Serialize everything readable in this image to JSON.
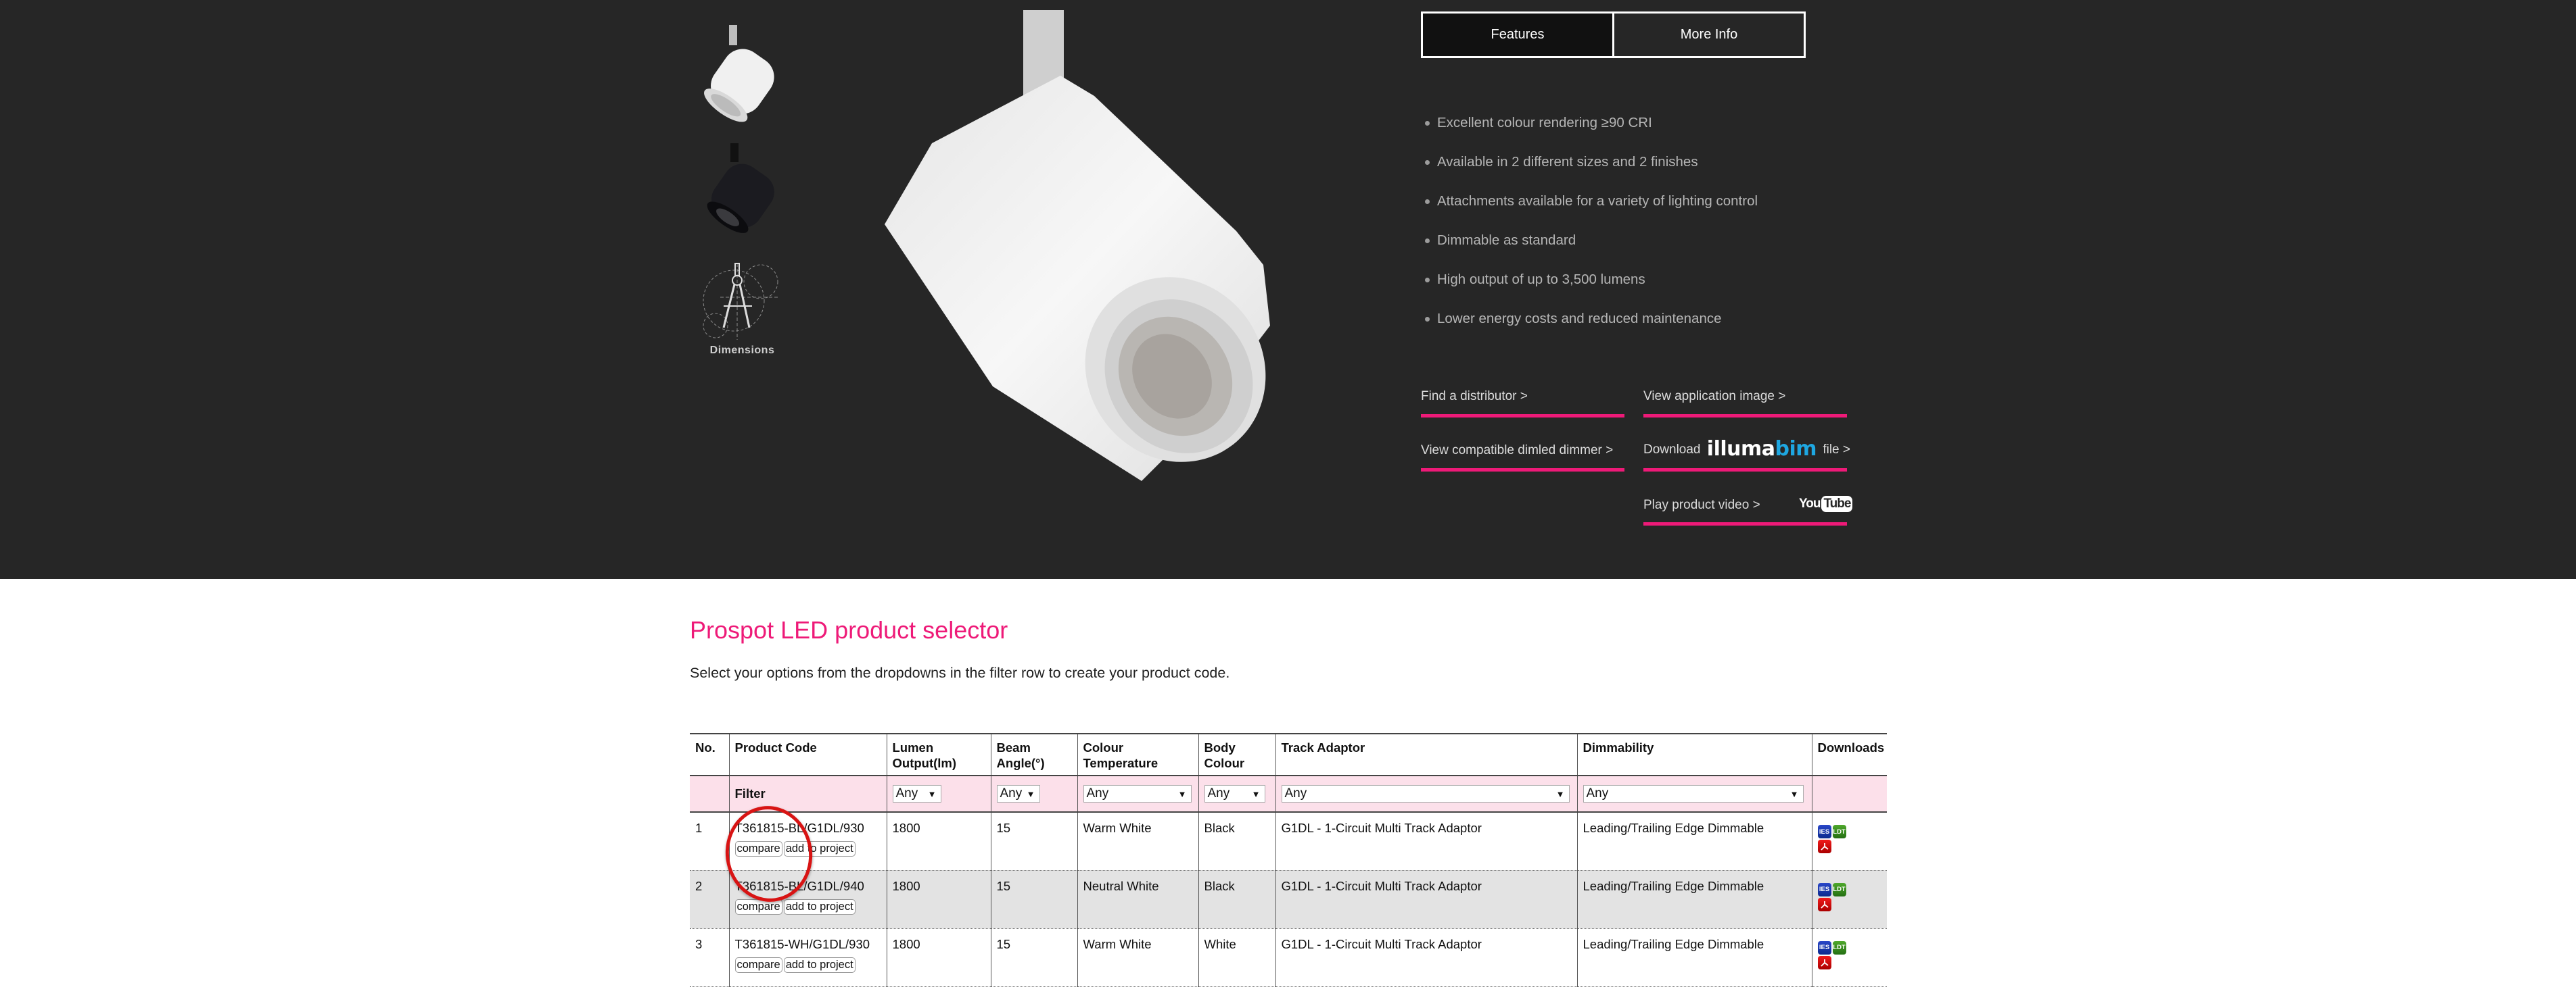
{
  "gallery": {
    "thumbnails": [
      {
        "name": "white-finish",
        "label": ""
      },
      {
        "name": "black-finish",
        "label": ""
      },
      {
        "name": "dimensions",
        "label": "Dimensions"
      }
    ]
  },
  "tabs": [
    {
      "label": "Features",
      "active": true
    },
    {
      "label": "More Info",
      "active": false
    }
  ],
  "features": [
    "Excellent colour rendering ≥90 CRI",
    "Available in 2 different sizes and 2 finishes",
    "Attachments available for a variety of lighting control",
    "Dimmable as standard",
    "High output of up to 3,500 lumens",
    "Lower energy costs and reduced maintenance"
  ],
  "links": {
    "find_distributor": "Find a distributor >",
    "view_application_image": "View application image >",
    "view_dimmer": "View compatible dimled dimmer >",
    "download_prefix": "Download",
    "illumabim_logo_part1": "illuma",
    "illumabim_logo_part2": "bim",
    "download_suffix": "file >",
    "play_video": "Play product video >",
    "youtube_you": "You",
    "youtube_tube": "Tube"
  },
  "colors": {
    "accent_pink": "#ee1a78",
    "dark_bg": "#262626",
    "filter_row_bg": "#fce0ea",
    "illumabim_blue": "#1ea7e1"
  },
  "selector": {
    "title": "Prospot LED product selector",
    "subtitle": "Select your options from the dropdowns in the filter row to create your product code.",
    "columns": [
      "No.",
      "Product Code",
      "Lumen Output(lm)",
      "Beam Angle(°)",
      "Colour Temperature",
      "Body Colour",
      "Track Adaptor",
      "Dimmability",
      "Downloads"
    ],
    "filter": {
      "label": "Filter",
      "lumen": "Any",
      "beam": "Any",
      "colour_temp": "Any",
      "body_colour": "Any",
      "track_adaptor": "Any",
      "dimmability": "Any"
    },
    "buttons": {
      "compare": "compare",
      "add_to_project": "add to project"
    },
    "downloads": {
      "ies": "IES",
      "ldt": "LDT",
      "pdf": "PDF"
    },
    "rows": [
      {
        "no": "1",
        "code": "T361815-BL/G1DL/930",
        "lumen": "1800",
        "beam": "15",
        "colour_temp": "Warm White",
        "body_colour": "Black",
        "track_adaptor": "G1DL - 1-Circuit Multi Track Adaptor",
        "dimmability": "Leading/Trailing Edge Dimmable"
      },
      {
        "no": "2",
        "code": "T361815-BL/G1DL/940",
        "lumen": "1800",
        "beam": "15",
        "colour_temp": "Neutral White",
        "body_colour": "Black",
        "track_adaptor": "G1DL - 1-Circuit Multi Track Adaptor",
        "dimmability": "Leading/Trailing Edge Dimmable"
      },
      {
        "no": "3",
        "code": "T361815-WH/G1DL/930",
        "lumen": "1800",
        "beam": "15",
        "colour_temp": "Warm White",
        "body_colour": "White",
        "track_adaptor": "G1DL - 1-Circuit Multi Track Adaptor",
        "dimmability": "Leading/Trailing Edge Dimmable"
      }
    ]
  }
}
